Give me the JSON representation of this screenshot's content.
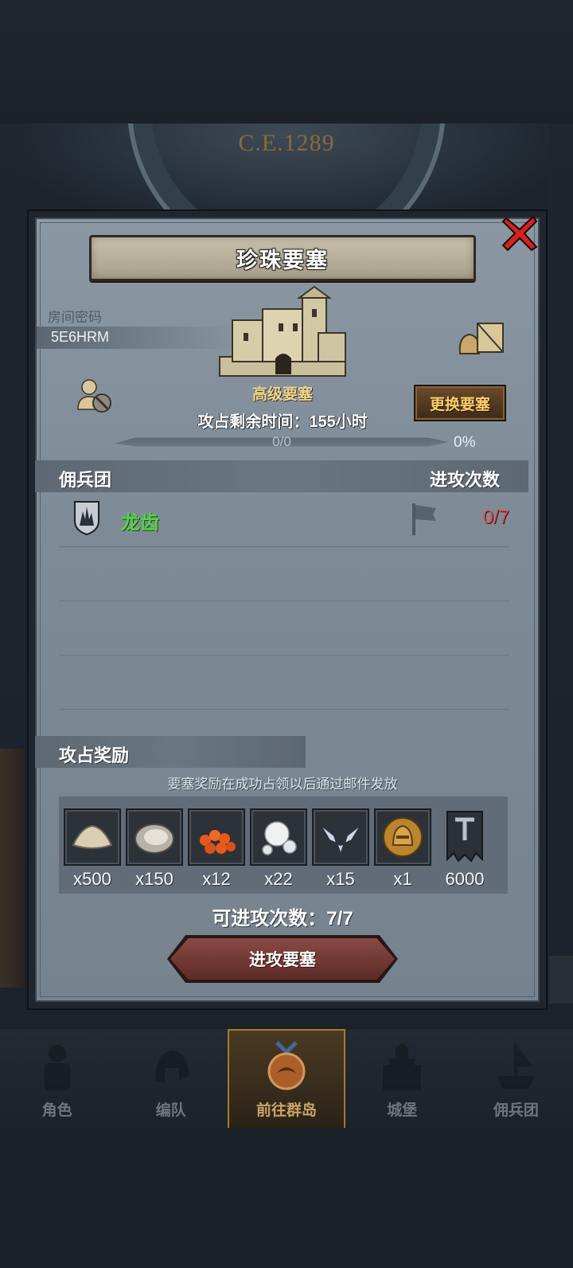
{
  "background": {
    "era_year": "C.E.1289"
  },
  "dialog": {
    "title": "珍珠要塞",
    "room_password_label": "房间密码",
    "room_code": "5E6HRM",
    "fortress_type": "高级要塞",
    "remaining_time": "攻占剩余时间：155小时",
    "change_button": "更换要塞",
    "progress": {
      "text": "0/0",
      "percent_label": "0%",
      "fraction": 0
    },
    "mercenary_header": "佣兵团",
    "attack_count_header": "进攻次数",
    "mercenaries": [
      {
        "name": "龙齿",
        "attacks": "0/7"
      }
    ],
    "rewards_header": "攻占奖励",
    "rewards_note": "要塞奖励在成功占领以后通过邮件发放",
    "rewards": [
      {
        "icon": "sand-icon",
        "qty": "x500"
      },
      {
        "icon": "oyster-icon",
        "qty": "x150"
      },
      {
        "icon": "fish-roe-icon",
        "qty": "x12"
      },
      {
        "icon": "pearl-icon",
        "qty": "x22"
      },
      {
        "icon": "winged-helm-icon",
        "qty": "x15"
      },
      {
        "icon": "golden-helmet-icon",
        "qty": "x1"
      },
      {
        "icon": "guild-banner-icon",
        "qty": "6000"
      }
    ],
    "attempts_left": "可进攻次数：7/7",
    "attack_button": "进攻要塞"
  },
  "bottom_nav": [
    {
      "label": "角色",
      "icon": "knight-icon",
      "active": false
    },
    {
      "label": "编队",
      "icon": "helmet-icon",
      "active": false
    },
    {
      "label": "前往群岛",
      "icon": "dragon-emblem-icon",
      "active": true
    },
    {
      "label": "城堡",
      "icon": "castle-icon",
      "active": false
    },
    {
      "label": "佣兵团",
      "icon": "ship-icon",
      "active": false
    }
  ],
  "colors": {
    "accent_gold": "#f0d68a",
    "merc_green": "#54d446",
    "count_red": "#e04a4a",
    "button_orange": "#ffcf6a"
  }
}
